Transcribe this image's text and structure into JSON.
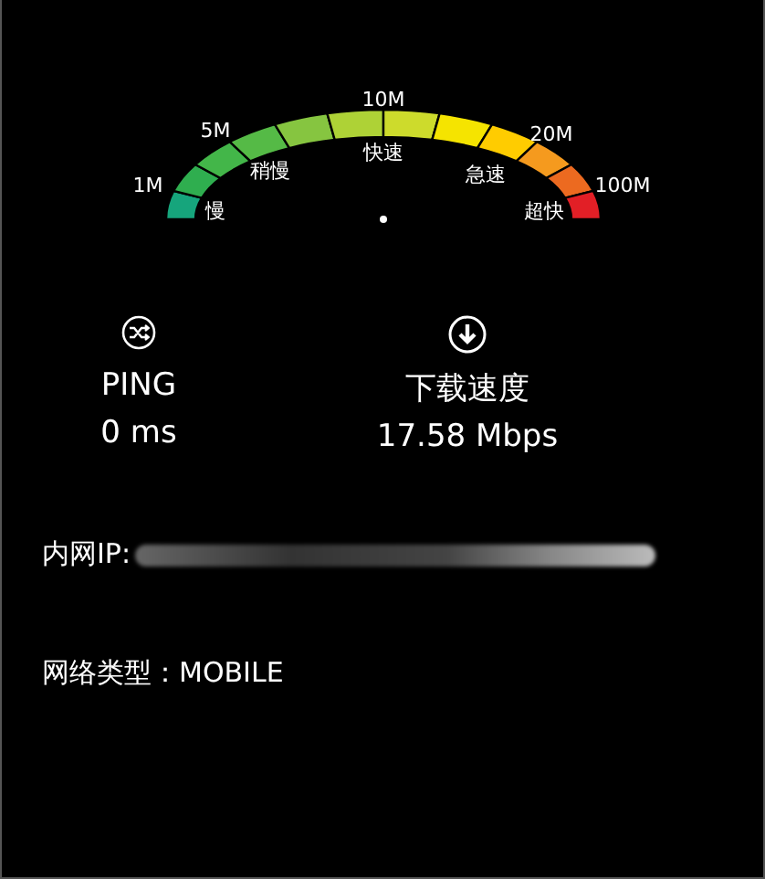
{
  "gauge": {
    "scale_labels": [
      "1M",
      "5M",
      "10M",
      "20M",
      "100M"
    ],
    "zone_labels": [
      "慢",
      "稍慢",
      "快速",
      "急速",
      "超快"
    ]
  },
  "ping": {
    "label": "PING",
    "value": "0 ms"
  },
  "download": {
    "label": "下载速度",
    "value": "17.58 Mbps"
  },
  "info": [
    {
      "kind": "redacted",
      "text": "内网IP:"
    },
    {
      "kind": "plain",
      "text": "网络类型：MOBILE"
    }
  ]
}
